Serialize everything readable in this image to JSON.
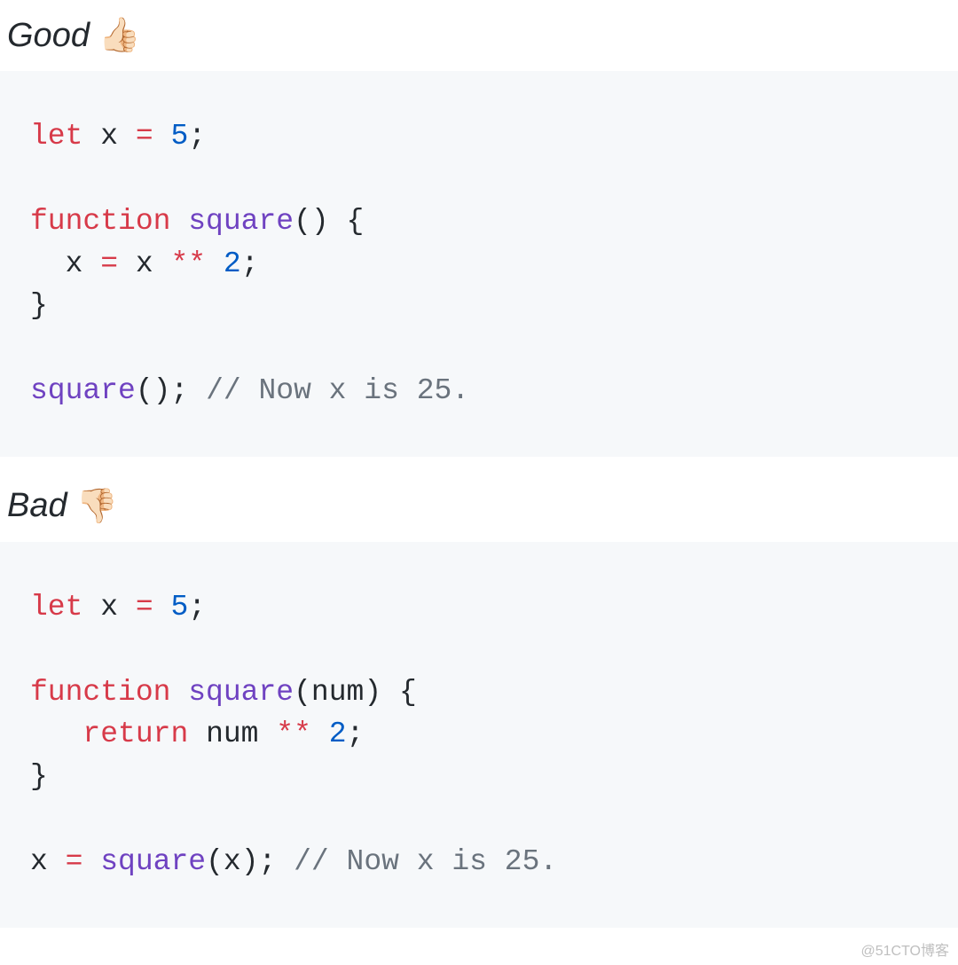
{
  "section_good": {
    "label": "Good",
    "emoji": "👍🏻"
  },
  "section_bad": {
    "label": "Bad",
    "emoji": "👎🏻"
  },
  "code_good": {
    "kw_let": "let",
    "var_x": "x",
    "op_eq": "=",
    "num_5": "5",
    "semi": ";",
    "kw_function": "function",
    "fn_square": "square",
    "parens_empty": "()",
    "brace_open": "{",
    "brace_close": "}",
    "op_exp": "**",
    "num_2": "2",
    "call_square": "square",
    "parens_call": "();",
    "comment": "// Now x is 25."
  },
  "code_bad": {
    "kw_let": "let",
    "var_x": "x",
    "op_eq": "=",
    "num_5": "5",
    "semi": ";",
    "kw_function": "function",
    "fn_square": "square",
    "param_open": "(",
    "param_name": "num",
    "param_close": ")",
    "brace_open": "{",
    "brace_close": "}",
    "kw_return": "return",
    "var_num": "num",
    "op_exp": "**",
    "num_2": "2",
    "call_square": "square",
    "call_open": "(",
    "call_arg": "x",
    "call_close": ");",
    "comment": "// Now x is 25."
  },
  "watermark": "@51CTO博客"
}
